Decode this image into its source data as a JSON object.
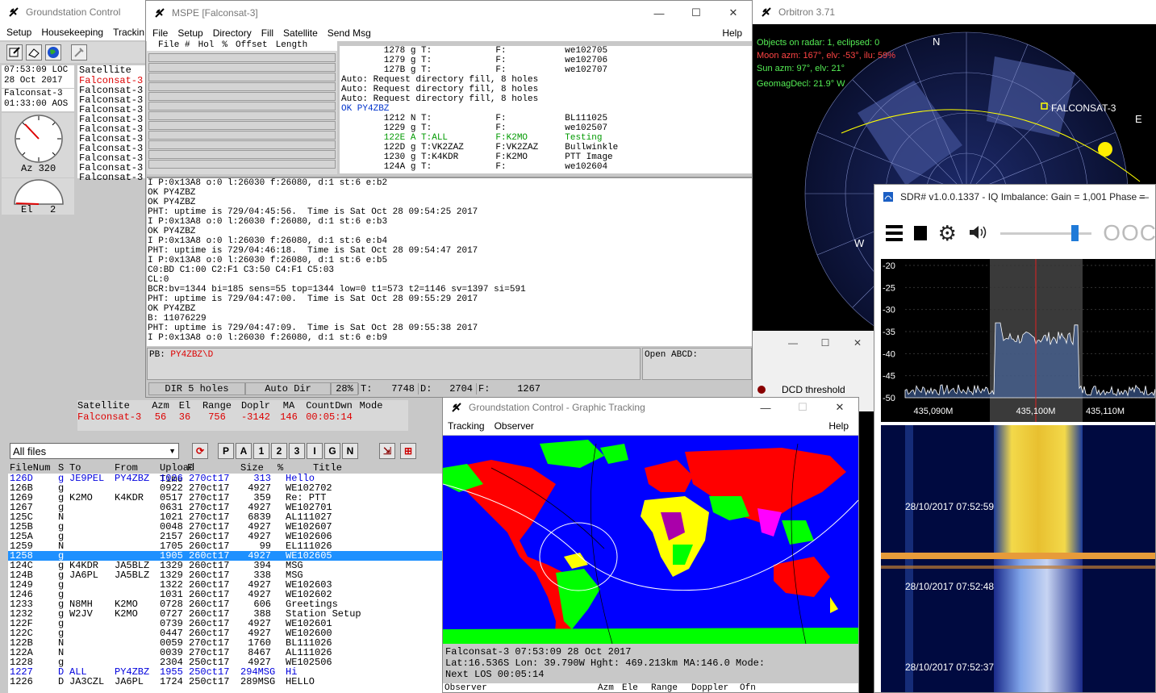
{
  "gc": {
    "title": "Groundstation Control",
    "menu": [
      "Setup",
      "Housekeeping",
      "Trackin"
    ],
    "time_line": "07:53:09 LOC",
    "date_line": "28 Oct 2017",
    "sat_name": "Falconsat-3",
    "aos_line": "01:33:00 AOS",
    "az_label": "Az 320",
    "el_label": "El",
    "el_value": "2",
    "sat_header": "Satellite",
    "sat_list": [
      "Falconsat-3",
      "Falconsat-3",
      "Falconsat-3",
      "Falconsat-3",
      "Falconsat-3",
      "Falconsat-3",
      "Falconsat-3",
      "Falconsat-3",
      "Falconsat-3",
      "Falconsat-3",
      "Falconsat-3"
    ],
    "track_header": [
      "Satellite",
      "Azm",
      "El",
      "Range",
      "Doplr",
      "MA",
      "CountDwn",
      "Mode"
    ],
    "track_row": [
      "Falconsat-3",
      "56",
      "36",
      "756",
      "-3142",
      "146",
      "00:05:14",
      ""
    ],
    "filter_value": "All files",
    "filter_buttons": [
      "P",
      "A",
      "1",
      "2",
      "3",
      "I",
      "G",
      "N"
    ],
    "dir_header": [
      "FileNum",
      "S",
      "To",
      "From",
      "Upload Time",
      "F",
      "Size",
      "%",
      "Title"
    ],
    "dir_rows": [
      [
        "126D",
        "g",
        "JE9PEL",
        "PY4ZBZ",
        "1026",
        "270ct17",
        "313",
        "Hello",
        "blue"
      ],
      [
        "126B",
        "g",
        "",
        "",
        "0922",
        "270ct17",
        "4927",
        "WE102702",
        ""
      ],
      [
        "1269",
        "g",
        "K2MO",
        "K4KDR",
        "0517",
        "270ct17",
        "359",
        "Re: PTT",
        ""
      ],
      [
        "1267",
        "g",
        "",
        "",
        "0631",
        "270ct17",
        "4927",
        "WE102701",
        ""
      ],
      [
        "125C",
        "N",
        "",
        "",
        "1021",
        "270ct17",
        "6839",
        "AL111027",
        ""
      ],
      [
        "125B",
        "g",
        "",
        "",
        "0048",
        "270ct17",
        "4927",
        "WE102607",
        ""
      ],
      [
        "125A",
        "g",
        "",
        "",
        "2157",
        "260ct17",
        "4927",
        "WE102606",
        ""
      ],
      [
        "1259",
        "N",
        "",
        "",
        "1705",
        "260ct17",
        "99",
        "EL111026",
        ""
      ],
      [
        "1258",
        "g",
        "",
        "",
        "1905",
        "260ct17",
        "4927",
        "WE102605",
        "sel"
      ],
      [
        "124C",
        "g",
        "K4KDR",
        "JA5BLZ",
        "1329",
        "260ct17",
        "394",
        "MSG",
        ""
      ],
      [
        "124B",
        "g",
        "JA6PL",
        "JA5BLZ",
        "1329",
        "260ct17",
        "338",
        "MSG",
        ""
      ],
      [
        "1249",
        "g",
        "",
        "",
        "1322",
        "260ct17",
        "4927",
        "WE102603",
        ""
      ],
      [
        "1246",
        "g",
        "",
        "",
        "1031",
        "260ct17",
        "4927",
        "WE102602",
        ""
      ],
      [
        "1233",
        "g",
        "N8MH",
        "K2MO",
        "0728",
        "260ct17",
        "606",
        "Greetings",
        ""
      ],
      [
        "1232",
        "g",
        "W2JV",
        "K2MO",
        "0727",
        "260ct17",
        "388",
        "Station Setup",
        ""
      ],
      [
        "122F",
        "g",
        "",
        "",
        "0739",
        "260ct17",
        "4927",
        "WE102601",
        ""
      ],
      [
        "122C",
        "g",
        "",
        "",
        "0447",
        "260ct17",
        "4927",
        "WE102600",
        ""
      ],
      [
        "122B",
        "N",
        "",
        "",
        "0059",
        "270ct17",
        "1760",
        "BL111026",
        ""
      ],
      [
        "122A",
        "N",
        "",
        "",
        "0039",
        "270ct17",
        "8467",
        "AL111026",
        ""
      ],
      [
        "1228",
        "g",
        "",
        "",
        "2304",
        "250ct17",
        "4927",
        "WE102506",
        ""
      ],
      [
        "1227",
        "D",
        "ALL",
        "PY4ZBZ",
        "1955",
        "250ct17",
        "294MSG",
        "Hi",
        "blue"
      ],
      [
        "1226",
        "D",
        "JA3CZL",
        "JA6PL",
        "1724",
        "250ct17",
        "289MSG",
        "HELLO",
        ""
      ]
    ]
  },
  "mspe": {
    "title": "MSPE [Falconsat-3]",
    "menu": [
      "File",
      "Setup",
      "Directory",
      "Fill",
      "Satellite",
      "Send Msg"
    ],
    "help": "Help",
    "hole_header": [
      "File #",
      "Hol",
      "%",
      "Offset",
      "Length"
    ],
    "top_lines": [
      {
        "t": "        1278 g T:            F:           we102705",
        "c": "#000"
      },
      {
        "t": "        1279 g T:            F:           we102706",
        "c": "#000"
      },
      {
        "t": "        127B g T:            F:           we102707",
        "c": "#000"
      },
      {
        "t": "Auto: Request directory fill, 8 holes",
        "c": "#000"
      },
      {
        "t": "Auto: Request directory fill, 8 holes",
        "c": "#000"
      },
      {
        "t": "Auto: Request directory fill, 8 holes",
        "c": "#000"
      },
      {
        "t": "OK PY4ZBZ",
        "c": "#0033cc"
      },
      {
        "t": "        1212 N T:            F:           BL111025",
        "c": "#000"
      },
      {
        "t": "        1229 g T:            F:           we102507",
        "c": "#000"
      },
      {
        "t": "        122E A T:ALL         F:K2MO       Testing",
        "c": "#009900"
      },
      {
        "t": "        122D g T:VK2ZAZ      F:VK2ZAZ     Bullwinkle",
        "c": "#000"
      },
      {
        "t": "        1230 g T:K4KDR       F:K2MO       PTT Image",
        "c": "#000"
      },
      {
        "t": "        124A g T:            F:           we102604",
        "c": "#000"
      }
    ],
    "log_lines": [
      "I P:0x13A8 o:0 l:26030 f:26080, d:1 st:6 e:b2",
      "OK PY4ZBZ",
      "OK PY4ZBZ",
      "PHT: uptime is 729/04:45:56.  Time is Sat Oct 28 09:54:25 2017",
      "I P:0x13A8 o:0 l:26030 f:26080, d:1 st:6 e:b3",
      "OK PY4ZBZ",
      "I P:0x13A8 o:0 l:26030 f:26080, d:1 st:6 e:b4",
      "PHT: uptime is 729/04:46:18.  Time is Sat Oct 28 09:54:47 2017",
      "I P:0x13A8 o:0 l:26030 f:26080, d:1 st:6 e:b5",
      "C0:BD C1:00 C2:F1 C3:50 C4:F1 C5:03",
      "CL:0",
      "BCR:bv=1344 bi=185 sens=55 top=1344 low=0 t1=573 t2=1146 sv=1397 si=591",
      "PHT: uptime is 729/04:47:00.  Time is Sat Oct 28 09:55:29 2017",
      "OK PY4ZBZ",
      "B: 11076229",
      "PHT: uptime is 729/04:47:09.  Time is Sat Oct 28 09:55:38 2017",
      "I P:0x13A8 o:0 l:26030 f:26080, d:1 st:6 e:b9"
    ],
    "pb_label": "PB:",
    "pb_value": "PY4ZBZ\\D",
    "open_label": "Open ABCD:",
    "status": [
      "DIR 5 holes",
      "Auto Dir",
      "28%",
      "T:",
      "7748",
      "D:",
      "2704",
      "F:",
      "1267"
    ]
  },
  "orbitron": {
    "title": "Orbitron 3.71",
    "info": [
      "Objects on radar: 1, eclipsed: 0",
      "Moon azm: 167°, elv: -53°, ilu: 59%",
      "Sun azm: 97°, elv: 21°",
      "GeomagDecl: 21.9° W"
    ],
    "sat_label": "FALCONSAT-3",
    "n": "N",
    "e": "E",
    "w": "W",
    "dcd": "DCD threshold"
  },
  "sdr": {
    "title": "SDR# v1.0.0.1337 - IQ Imbalance: Gain = 1,001 Phase =",
    "freq_digits": "OOC",
    "ylabels": [
      "-20",
      "-25",
      "-30",
      "-35",
      "-40",
      "-45",
      "-50"
    ],
    "xlabels": [
      "435,090M",
      "435,100M",
      "435,110M"
    ],
    "wf_times": [
      "28/10/2017 07:52:59",
      "28/10/2017 07:52:48",
      "28/10/2017 07:52:37"
    ]
  },
  "gt": {
    "title": "Groundstation Control - Graphic Tracking",
    "menu": [
      "Tracking",
      "Observer"
    ],
    "help": "Help",
    "line1": "Falconsat-3    07:53:09 28 Oct 2017",
    "line2": "Lat:16.536S Lon: 39.790W  Hght:  469.213km  MA:146.0  Mode:",
    "line3": "Next LOS 00:05:14",
    "footer": [
      "Observer",
      "Azm",
      "Ele",
      "Range",
      "Doppler",
      "Ofn"
    ]
  }
}
